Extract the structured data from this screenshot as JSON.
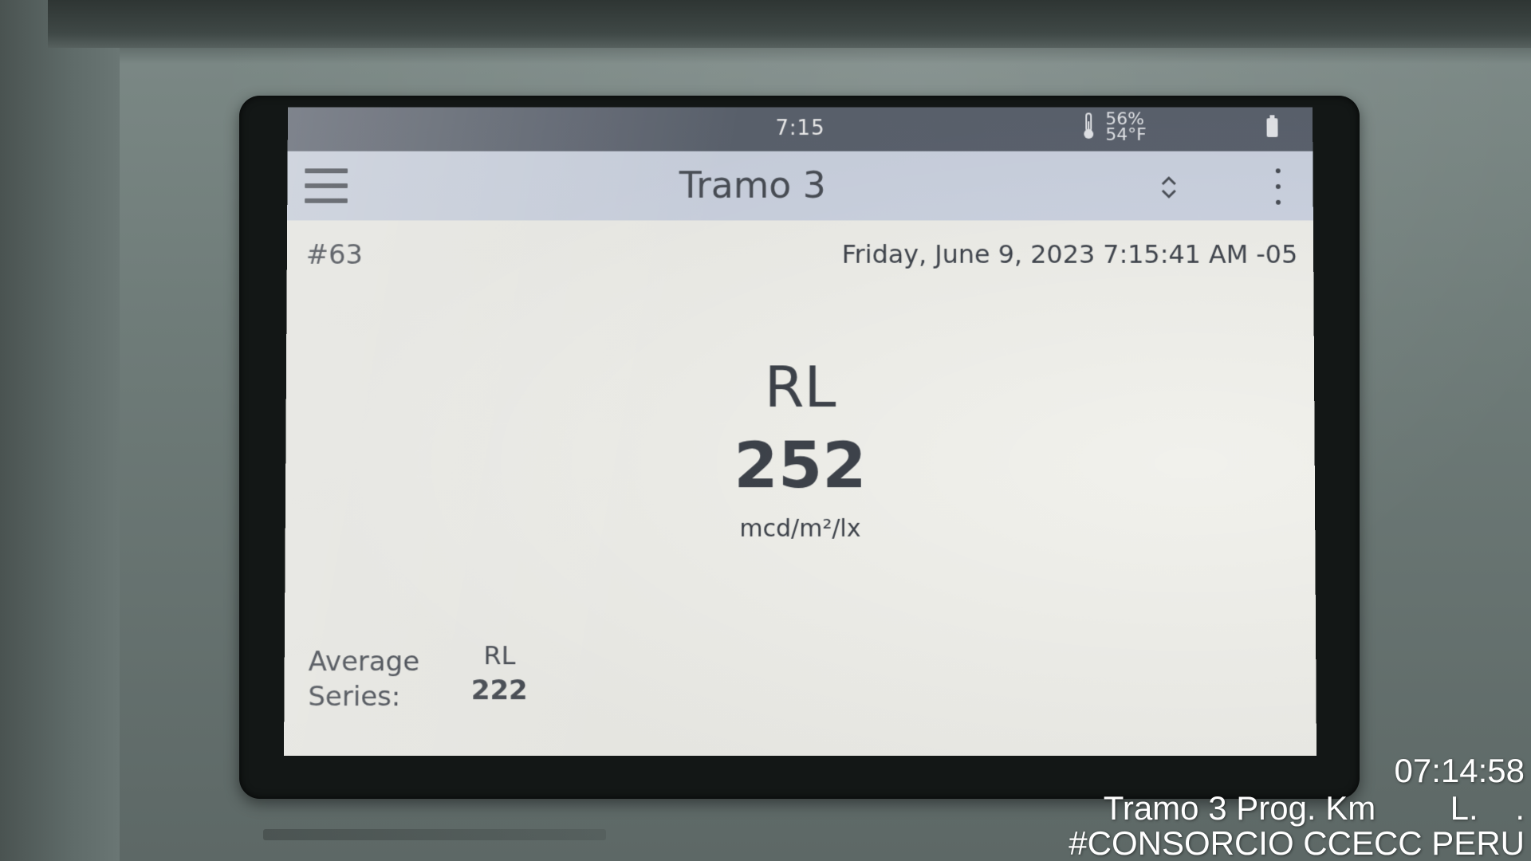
{
  "status_bar": {
    "time": "7:15",
    "humidity": "56%",
    "temperature": "54°F",
    "thermometer_icon": "thermometer-icon",
    "battery_icon": "battery-icon"
  },
  "app_bar": {
    "menu_icon": "hamburger-menu-icon",
    "title": "Tramo 3",
    "sort_icon": "sort-up-down-icon",
    "more_icon": "more-vertical-icon"
  },
  "record": {
    "number": "#63",
    "datetime": "Friday, June 9, 2023 7:15:41 AM -05"
  },
  "reading": {
    "label": "RL",
    "value": "252",
    "unit": "mcd/m²/lx"
  },
  "average": {
    "label_line1": "Average",
    "label_line2": "Series:",
    "rl_label": "RL",
    "rl_value": "222"
  },
  "photo_watermark": {
    "time": "07:14:58",
    "location": "Tramo 3 Prog. Km        L.    .",
    "company": "#CONSORCIO CCECC PERU"
  },
  "colors": {
    "status_bar_bg": "#5d6470",
    "app_bar_bg": "#cfd6e4",
    "screen_bg": "#f1f1ec",
    "text": "#41464e"
  }
}
